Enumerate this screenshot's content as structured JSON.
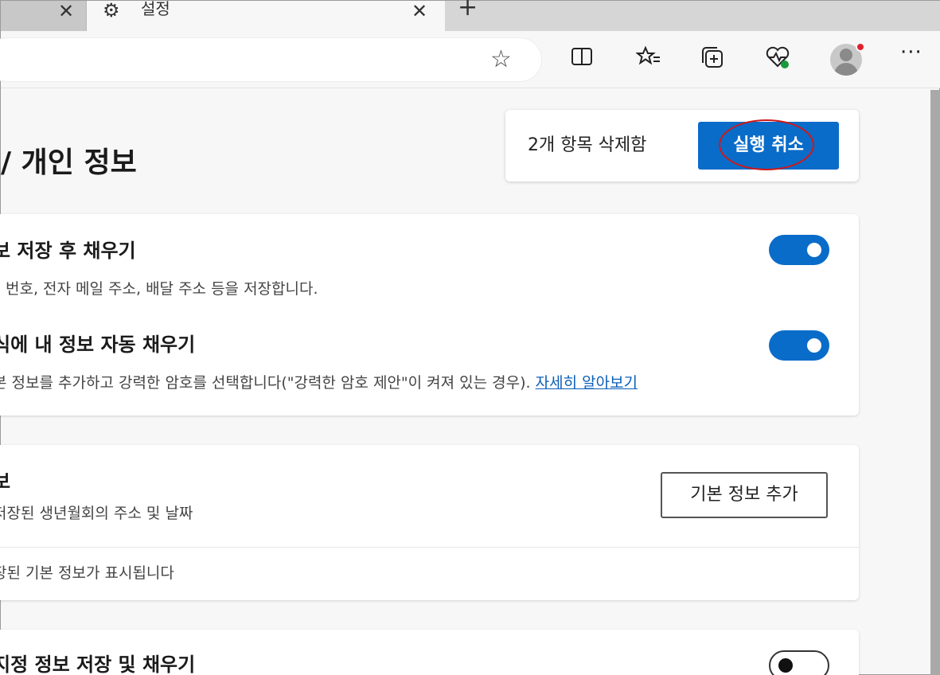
{
  "tabs": {
    "prev_close": "✕",
    "active_title": "설정",
    "active_close": "✕",
    "new_tab": "+"
  },
  "toolbar": {
    "favorite_icon": "star-icon",
    "icons": [
      "split-screen-icon",
      "favorites-icon",
      "collections-icon",
      "browser-essentials-icon"
    ],
    "more": "···"
  },
  "page": {
    "title": "/ 개인 정보"
  },
  "toast": {
    "message": "2개 항목 삭제함",
    "undo_label": "실행 취소"
  },
  "settings": {
    "save_fill": {
      "title": "보 저장 후 채우기",
      "description": "번호, 전자 메일 주소, 배달 주소 등을 저장합니다.",
      "enabled": true
    },
    "autofill_forms": {
      "title": "식에 내 정보 자동 채우기",
      "description": "본 정보를 추가하고 강력한 암호를 선택합니다(\"강력한 암호 제안\"이 켜져 있는 경우).",
      "link": "자세히 알아보기",
      "enabled": true
    },
    "basic_info": {
      "title": "보",
      "description": "저장된 생년월회의 주소 및 날짜",
      "add_button": "기본 정보 추가",
      "empty_text": "장된 기본 정보가 표시됩니다"
    },
    "custom_info": {
      "title": "지정 정보 저장 및 채우기",
      "enabled": false
    }
  }
}
